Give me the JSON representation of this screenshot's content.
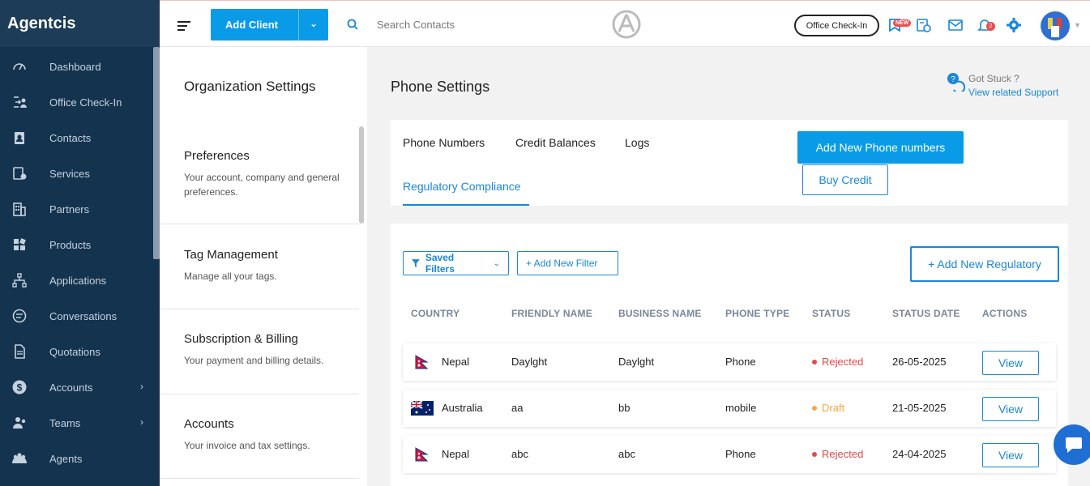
{
  "sidebar": {
    "brand": "Agentcis",
    "items": [
      {
        "label": "Dashboard",
        "icon": "gauge-icon"
      },
      {
        "label": "Office Check-In",
        "icon": "checkin-icon"
      },
      {
        "label": "Contacts",
        "icon": "contacts-icon"
      },
      {
        "label": "Services",
        "icon": "services-icon"
      },
      {
        "label": "Partners",
        "icon": "building-icon"
      },
      {
        "label": "Products",
        "icon": "grid-icon"
      },
      {
        "label": "Applications",
        "icon": "flow-icon"
      },
      {
        "label": "Conversations",
        "icon": "chat-icon"
      },
      {
        "label": "Quotations",
        "icon": "document-icon"
      },
      {
        "label": "Accounts",
        "icon": "dollar-icon",
        "chevron": "›"
      },
      {
        "label": "Teams",
        "icon": "team-icon",
        "chevron": "›"
      },
      {
        "label": "Agents",
        "icon": "agents-icon"
      }
    ]
  },
  "header": {
    "add_client_label": "Add Client",
    "add_client_chevron": "⌄",
    "search_placeholder": "Search Contacts",
    "office_checkin_label": "Office Check-In",
    "new_badge": "NEW",
    "notification_count": "2"
  },
  "org_settings": {
    "title": "Organization Settings",
    "sections": [
      {
        "title": "Preferences",
        "desc": "Your account, company and general preferences."
      },
      {
        "title": "Tag Management",
        "desc": "Manage all your tags."
      },
      {
        "title": "Subscription & Billing",
        "desc": "Your payment and billing details."
      },
      {
        "title": "Accounts",
        "desc": "Your invoice and tax settings."
      }
    ]
  },
  "main": {
    "title": "Phone Settings",
    "help": {
      "line1": "Got Stuck ?",
      "line2": "View related Support"
    },
    "tabs": [
      {
        "label": "Phone Numbers",
        "active": false
      },
      {
        "label": "Credit Balances",
        "active": false
      },
      {
        "label": "Logs",
        "active": false
      },
      {
        "label": "Regulatory Compliance",
        "active": true
      }
    ],
    "add_phone_label": "Add New Phone numbers",
    "buy_credit_label": "Buy Credit",
    "saved_filters_label": "Saved Filters",
    "add_filter_label": "+ Add New Filter",
    "add_regulatory_label": "+ Add New Regulatory",
    "columns": [
      "COUNTRY",
      "FRIENDLY NAME",
      "BUSINESS NAME",
      "PHONE TYPE",
      "STATUS",
      "STATUS DATE",
      "ACTIONS"
    ],
    "rows": [
      {
        "country": "Nepal",
        "flag": "nepal",
        "friendly": "Daylght",
        "business": "Daylght",
        "type": "Phone",
        "status": "Rejected",
        "status_color": "#e24b4b",
        "date": "26-05-2025",
        "action": "View"
      },
      {
        "country": "Australia",
        "flag": "australia",
        "friendly": "aa",
        "business": "bb",
        "type": "mobile",
        "status": "Draft",
        "status_color": "#f5a742",
        "date": "21-05-2025",
        "action": "View"
      },
      {
        "country": "Nepal",
        "flag": "nepal",
        "friendly": "abc",
        "business": "abc",
        "type": "Phone",
        "status": "Rejected",
        "status_color": "#e24b4b",
        "date": "24-04-2025",
        "action": "View"
      }
    ]
  },
  "colors": {
    "primary": "#0a9be8",
    "sidebar": "#14334e",
    "link": "#1a87d8"
  }
}
